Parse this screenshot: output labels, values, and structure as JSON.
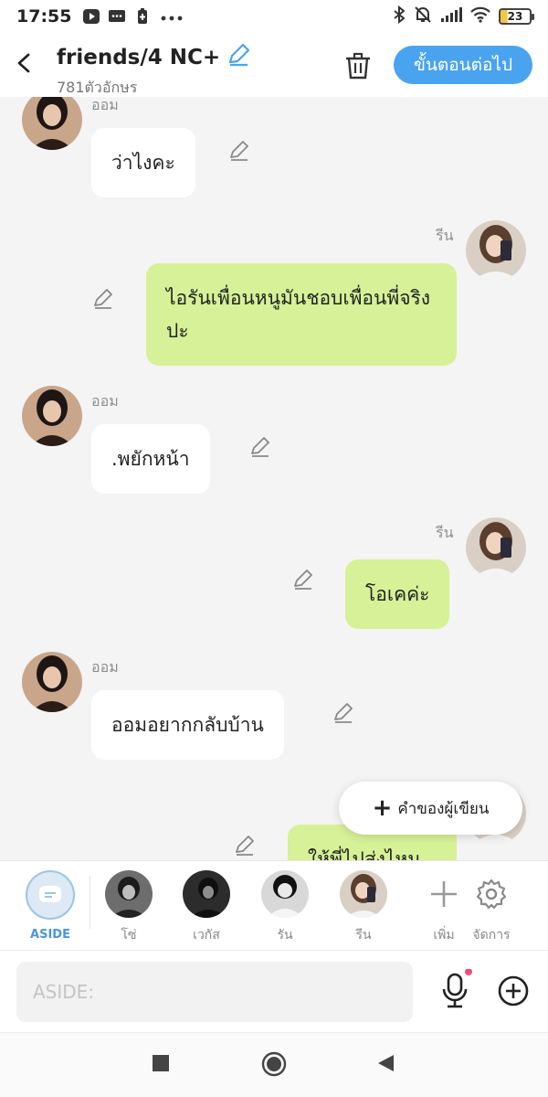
{
  "status_bar": {
    "time": "17:55",
    "battery": "23"
  },
  "header": {
    "title": "friends/4 NC+",
    "subtitle": "781ตัวอักษร",
    "next_label": "ขั้นตอนต่อไป"
  },
  "messages": [
    {
      "sender": "ออม",
      "text": "ว่าไงคะ",
      "side": "left"
    },
    {
      "sender": "รีน",
      "text": "ไอรันเพื่อนหนูมันชอบเพื่อนพี่จริงปะ",
      "side": "right"
    },
    {
      "sender": "ออม",
      "text": ".พยักหน้า",
      "side": "left"
    },
    {
      "sender": "รีน",
      "text": "โอเคค่ะ",
      "side": "right"
    },
    {
      "sender": "ออม",
      "text": "ออมอยากกลับบ้าน",
      "side": "left"
    },
    {
      "sender": "รีน",
      "text": "ให้พี่ไปส่งไหม",
      "side": "right"
    }
  ],
  "fab_label": "คำของผู้เขียน",
  "characters": [
    {
      "label": "ASIDE"
    },
    {
      "label": "โซ่"
    },
    {
      "label": "เวกัส"
    },
    {
      "label": "รัน"
    },
    {
      "label": "รีน"
    },
    {
      "label": "เพิ่ม"
    },
    {
      "label": "จัดการ"
    }
  ],
  "input": {
    "placeholder": "ASIDE:"
  },
  "colors": {
    "accent": "#4aa3ef",
    "my_bubble": "#d6f197",
    "notification_dot": "#f0506e"
  }
}
